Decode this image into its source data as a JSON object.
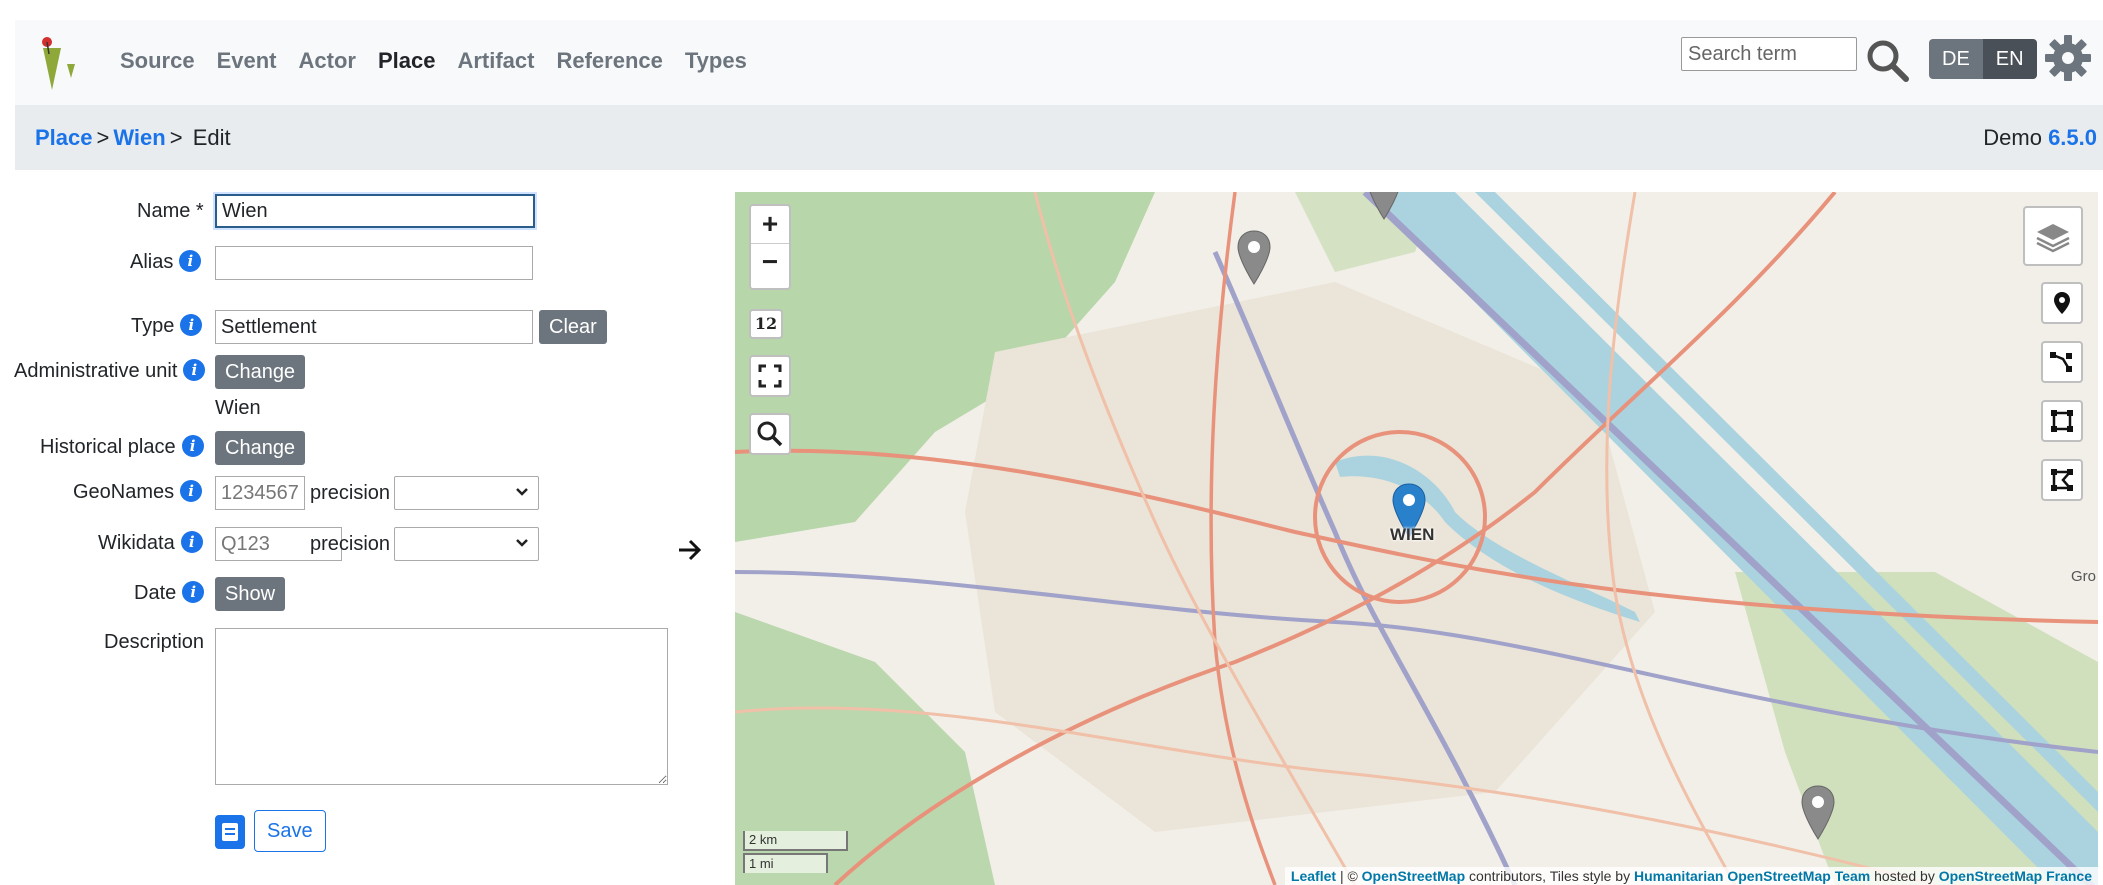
{
  "nav": {
    "links": [
      "Source",
      "Event",
      "Actor",
      "Place",
      "Artifact",
      "Reference",
      "Types"
    ],
    "active": "Place",
    "search_placeholder": "Search term",
    "lang": [
      "DE",
      "EN"
    ]
  },
  "breadcrumb": {
    "items": [
      "Place",
      "Wien"
    ],
    "current": "Edit",
    "separator": ">",
    "version_label": "Demo",
    "version": "6.5.0"
  },
  "form": {
    "name_label": "Name *",
    "name_value": "Wien",
    "alias_label": "Alias",
    "type_label": "Type",
    "type_value": "Settlement",
    "clear_label": "Clear",
    "admin_label": "Administrative unit",
    "admin_button": "Change",
    "admin_value": "Wien",
    "historical_label": "Historical place",
    "historical_button": "Change",
    "geonames_label": "GeoNames",
    "geonames_placeholder": "1234567",
    "precision_label": "precision",
    "wikidata_label": "Wikidata",
    "wikidata_placeholder": "Q123",
    "date_label": "Date",
    "date_button": "Show",
    "description_label": "Description",
    "save_label": "Save"
  },
  "map": {
    "zoom_in": "+",
    "zoom_out": "−",
    "zoom_level": "12",
    "marker_label": "WIEN",
    "scale_km": "2 km",
    "scale_mi": "1 mi",
    "attribution": {
      "leaflet": "Leaflet",
      "sep1": "| ©",
      "osm": "OpenStreetMap",
      "text1": "contributors, Tiles style by",
      "hot": "Humanitarian OpenStreetMap Team",
      "text2": "hosted by",
      "osmfr": "OpenStreetMap France"
    },
    "edge_label": "Gro",
    "colors": {
      "water": "#aad3df",
      "forest": "#add19e",
      "road": "#e8927c",
      "motorway": "#a1a2c9",
      "marker": "#2a81cb"
    }
  }
}
